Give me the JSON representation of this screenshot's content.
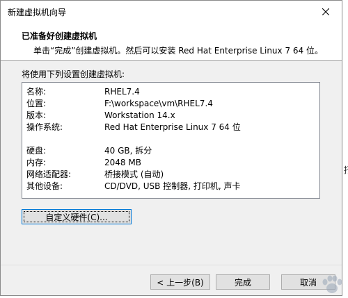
{
  "window": {
    "title": "新建虚拟机向导"
  },
  "header": {
    "title": "已准备好创建虚拟机",
    "subtitle": "单击“完成”创建虚拟机。然后可以安装 Red Hat Enterprise Linux 7 64 位。"
  },
  "intro": "将使用下列设置创建虚拟机:",
  "summary": {
    "rows": [
      {
        "key": "名称:",
        "value": "RHEL7.4"
      },
      {
        "key": "位置:",
        "value": "F:\\workspace\\vm\\RHEL7.4"
      },
      {
        "key": "版本:",
        "value": "Workstation 14.x"
      },
      {
        "key": "操作系统:",
        "value": "Red Hat Enterprise Linux 7 64 位"
      },
      {
        "key": "硬盘:",
        "value": "40 GB, 拆分"
      },
      {
        "key": "内存:",
        "value": "2048 MB"
      },
      {
        "key": "网络适配器:",
        "value": "桥接模式 (自动)"
      },
      {
        "key": "其他设备:",
        "value": "CD/DVD, USB 控制器, 打印机, 声卡"
      }
    ]
  },
  "buttons": {
    "customize": "自定义硬件(C)...",
    "back": "< 上一步(B)",
    "finish": "完成",
    "cancel": "取消"
  },
  "outside_text": "抒"
}
